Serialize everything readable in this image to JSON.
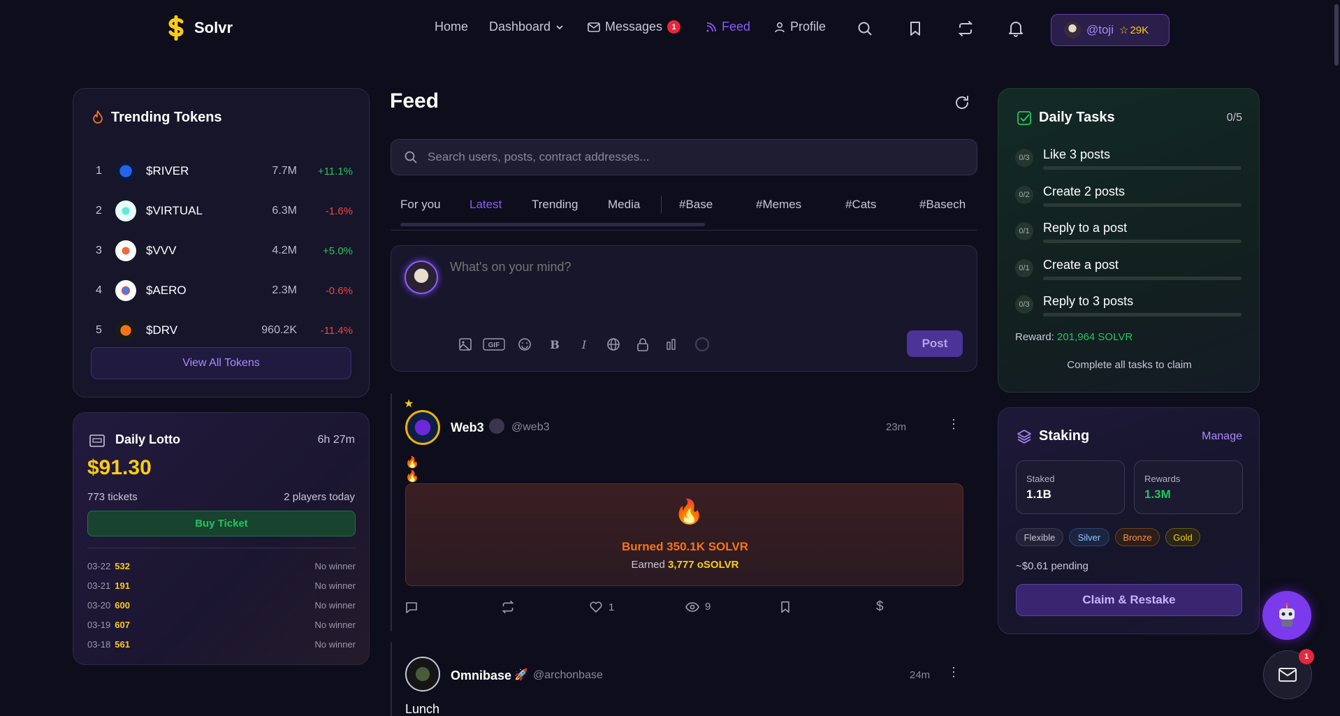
{
  "nav": {
    "brand": "Solvr",
    "links": [
      "Home",
      "Dashboard",
      "Messages",
      "Feed",
      "Profile"
    ],
    "messages_badge": "1",
    "user_handle": "@toji",
    "user_points": "29K",
    "accent": "#8b5cf6"
  },
  "trending": {
    "title": "Trending Tokens",
    "tokens": [
      {
        "rank": "1",
        "symbol": "$RIVER",
        "volume": "7.7M",
        "change": "+11.1%"
      },
      {
        "rank": "2",
        "symbol": "$VIRTUAL",
        "volume": "6.3M",
        "change": "-1.6%"
      },
      {
        "rank": "3",
        "symbol": "$VVV",
        "volume": "4.2M",
        "change": "+5.0%"
      },
      {
        "rank": "4",
        "symbol": "$AERO",
        "volume": "2.3M",
        "change": "-0.6%"
      },
      {
        "rank": "5",
        "symbol": "$DRV",
        "volume": "960.2K",
        "change": "-11.4%"
      }
    ],
    "view_all": "View All Tokens"
  },
  "lotto": {
    "title": "Daily Lotto",
    "time_left": "6h 27m",
    "pot": "$91.30",
    "tickets": "773 tickets",
    "players": "2 players today",
    "buy_label": "Buy Ticket",
    "history": [
      {
        "date": "03-22",
        "number": "532",
        "result": "No winner"
      },
      {
        "date": "03-21",
        "number": "191",
        "result": "No winner"
      },
      {
        "date": "03-20",
        "number": "600",
        "result": "No winner"
      },
      {
        "date": "03-19",
        "number": "607",
        "result": "No winner"
      },
      {
        "date": "03-18",
        "number": "561",
        "result": "No winner"
      }
    ]
  },
  "feed": {
    "title": "Feed",
    "search_placeholder": "Search users, posts, contract addresses...",
    "tabs": [
      "For you",
      "Latest",
      "Trending",
      "Media",
      "#Base",
      "#Memes",
      "#Cats",
      "#Basech"
    ],
    "active_tab": "Latest",
    "composer_placeholder": "What's on your mind?",
    "post_label": "Post",
    "posts": [
      {
        "name": "Web3",
        "handle": "@web3",
        "time": "23m",
        "body": "🔥🔥🔥🔥🔥🔥👹",
        "burn_title": "Burned 350.1K SOLVR",
        "burn_earned_prefix": "Earned",
        "burn_earned_value": "3,777 oSOLVR",
        "likes": "1",
        "views": "9"
      },
      {
        "name": "Omnibase",
        "handle": "@archonbase",
        "time": "24m",
        "body": "Lunch time"
      }
    ]
  },
  "tasks": {
    "title": "Daily Tasks",
    "progress": "0/5",
    "items": [
      {
        "count": "0/3",
        "label": "Like 3 posts"
      },
      {
        "count": "0/2",
        "label": "Create 2 posts"
      },
      {
        "count": "0/1",
        "label": "Reply to a post"
      },
      {
        "count": "0/1",
        "label": "Create a post"
      },
      {
        "count": "0/3",
        "label": "Reply to 3 posts"
      }
    ],
    "reward_label": "Reward:",
    "reward_value": "201,964 SOLVR",
    "claim_note": "Complete all tasks to claim"
  },
  "staking": {
    "title": "Staking",
    "manage": "Manage",
    "staked_label": "Staked",
    "staked_value": "1.1B",
    "rewards_label": "Rewards",
    "rewards_value": "1.3M",
    "tiers": [
      "Flexible",
      "Silver",
      "Bronze",
      "Gold"
    ],
    "pending": "~$0.61 pending",
    "claim_label": "Claim & Restake"
  },
  "mail_badge": "1"
}
